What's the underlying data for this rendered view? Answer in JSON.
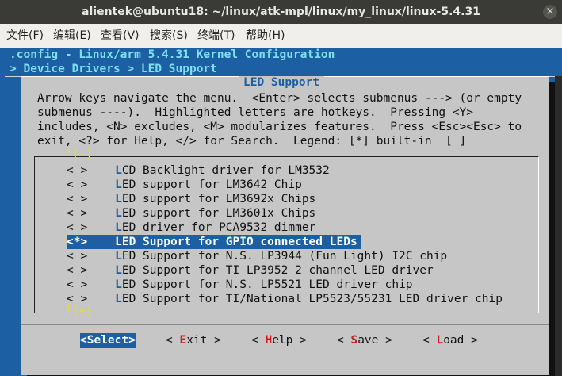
{
  "window": {
    "title": "alientek@ubuntu18: ~/linux/atk-mpl/linux/my_linux/linux-5.4.31",
    "close_glyph": "×"
  },
  "menubar": [
    "文件(F)",
    "编辑(E)",
    "查看(V)",
    "搜索(S)",
    "终端(T)",
    "帮助(H)"
  ],
  "header": {
    "config": ".config - Linux/arm 5.4.31 Kernel Configuration",
    "breadcrumb": "> Device Drivers > LED Support"
  },
  "dialog": {
    "title": "LED Support",
    "help": [
      "Arrow keys navigate the menu.  <Enter> selects submenus ---> (or empty",
      "submenus ----).  Highlighted letters are hotkeys.  Pressing <Y>",
      "includes, <N> excludes, <M> modularizes features.  Press <Esc><Esc> to",
      "exit, <?> for Help, </> for Search.  Legend: [*] built-in  [ ]"
    ],
    "scroll_up": "^(-)",
    "scroll_down": "└(+)",
    "items": [
      {
        "mark": "< >",
        "hotkey": "L",
        "rest": "CD Backlight driver for LM3532"
      },
      {
        "mark": "< >",
        "hotkey": "L",
        "rest": "ED support for LM3642 Chip"
      },
      {
        "mark": "< >",
        "hotkey": "L",
        "rest": "ED support for LM3692x Chips"
      },
      {
        "mark": "< >",
        "hotkey": "L",
        "rest": "ED support for LM3601x Chips"
      },
      {
        "mark": "< >",
        "hotkey": "L",
        "rest": "ED driver for PCA9532 dimmer"
      },
      {
        "mark": "<*>",
        "hotkey": "L",
        "rest": "ED Support for GPIO connected LEDs"
      },
      {
        "mark": "< >",
        "hotkey": "L",
        "rest": "ED Support for N.S. LP3944 (Fun Light) I2C chip"
      },
      {
        "mark": "< >",
        "hotkey": "L",
        "rest": "ED Support for TI LP3952 2 channel LED driver"
      },
      {
        "mark": "< >",
        "hotkey": "L",
        "rest": "ED Support for N.S. LP5521 LED driver chip"
      },
      {
        "mark": "< >",
        "hotkey": "L",
        "rest": "ED Support for TI/National LP5523/55231 LED driver chip"
      }
    ],
    "buttons": [
      {
        "pre": "<",
        "hotkey": "S",
        "rest": "elect>"
      },
      {
        "pre": "< ",
        "hotkey": "E",
        "rest": "xit >"
      },
      {
        "pre": "< ",
        "hotkey": "H",
        "rest": "elp >"
      },
      {
        "pre": "< ",
        "hotkey": "S",
        "rest": "ave >"
      },
      {
        "pre": "< ",
        "hotkey": "L",
        "rest": "oad >"
      }
    ]
  },
  "colors": {
    "terminal_bg": "#1d5fa3",
    "dialog_bg": "#c6c6c6",
    "hotkey": "#c61c1c",
    "header_text": "#7de0ee"
  }
}
